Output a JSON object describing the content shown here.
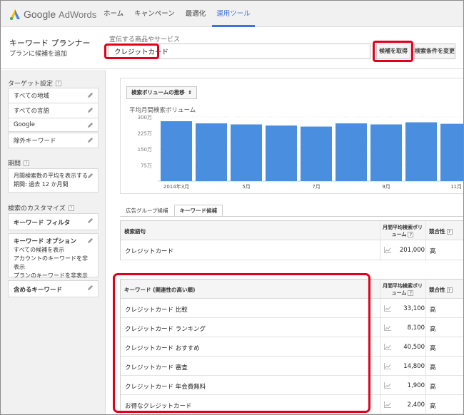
{
  "brand": {
    "logo_google": "Google",
    "logo_adwords": "AdWords",
    "icon": "adwords-logo-icon"
  },
  "nav": [
    {
      "label": "ホーム"
    },
    {
      "label": "キャンペーン"
    },
    {
      "label": "最適化"
    },
    {
      "label": "運用ツール",
      "active": true
    }
  ],
  "header": {
    "title": "キーワード プランナー",
    "subtitle": "プランに候補を追加",
    "product_label": "宣伝する商品やサービス",
    "product_value": "クレジットカード",
    "get_ideas_button": "候補を取得",
    "modify_search_button": "検索条件を変更"
  },
  "sidebar": {
    "targeting_heading": "ターゲット設定",
    "targeting_items": [
      "すべての地域",
      "すべての言語",
      "Google",
      "除外キーワード"
    ],
    "period_heading": "期間",
    "period_lines": [
      "月間検索数の平均を表示する",
      "期間: 過去 12 か月間"
    ],
    "customize_heading": "検索のカスタマイズ",
    "keyword_filter": "キーワード フィルタ",
    "keyword_options_title": "キーワード オプション",
    "keyword_options_lines": [
      "すべての候補を表示",
      "アカウントのキーワードを非表示",
      "プランのキーワードを非表示"
    ],
    "include_keywords": "含めるキーワード"
  },
  "chart": {
    "dropdown": "検索ボリュームの推移",
    "title": "平均月間検索ボリューム"
  },
  "chart_data": {
    "type": "bar",
    "title": "平均月間検索ボリューム",
    "x_tick_labels": [
      "2014年3月",
      "5月",
      "7月",
      "9月",
      "11月"
    ],
    "y_tick_labels": [
      "300万",
      "225万",
      "150万",
      "75万"
    ],
    "y_ticks": [
      3000000,
      2250000,
      1500000,
      750000
    ],
    "ylim": [
      0,
      3000000
    ],
    "values": [
      2800000,
      2700000,
      2650000,
      2600000,
      2550000,
      2700000,
      2650000,
      2750000,
      2680000
    ],
    "grid": true,
    "colors": {
      "bar": "#4a8ee0"
    }
  },
  "tabs": [
    {
      "label": "広告グループ候補"
    },
    {
      "label": "キーワード候補",
      "active": true
    }
  ],
  "search_table": {
    "header_keyword": "検索語句",
    "header_volume": "月間平均検索ボリューム",
    "header_competition": "競合性",
    "rows": [
      {
        "keyword": "クレジットカード",
        "volume": "201,000",
        "competition": "高"
      }
    ]
  },
  "ideas_table": {
    "header_keyword": "キーワード (関連性の高い順)",
    "header_volume": "月間平均検索ボリューム",
    "header_competition": "競合性",
    "rows": [
      {
        "keyword": "クレジットカード 比較",
        "volume": "33,100",
        "competition": "高"
      },
      {
        "keyword": "クレジットカード ランキング",
        "volume": "8,100",
        "competition": "高"
      },
      {
        "keyword": "クレジットカード おすすめ",
        "volume": "40,500",
        "competition": "高"
      },
      {
        "keyword": "クレジットカード 審査",
        "volume": "14,800",
        "competition": "高"
      },
      {
        "keyword": "クレジットカード 年会費無料",
        "volume": "1,900",
        "competition": "高"
      },
      {
        "keyword": "お得なクレジットカード",
        "volume": "2,400",
        "competition": "高"
      }
    ]
  },
  "colors": {
    "accent": "#3b73d8",
    "highlight": "#e0001b",
    "bar": "#4a8ee0"
  }
}
